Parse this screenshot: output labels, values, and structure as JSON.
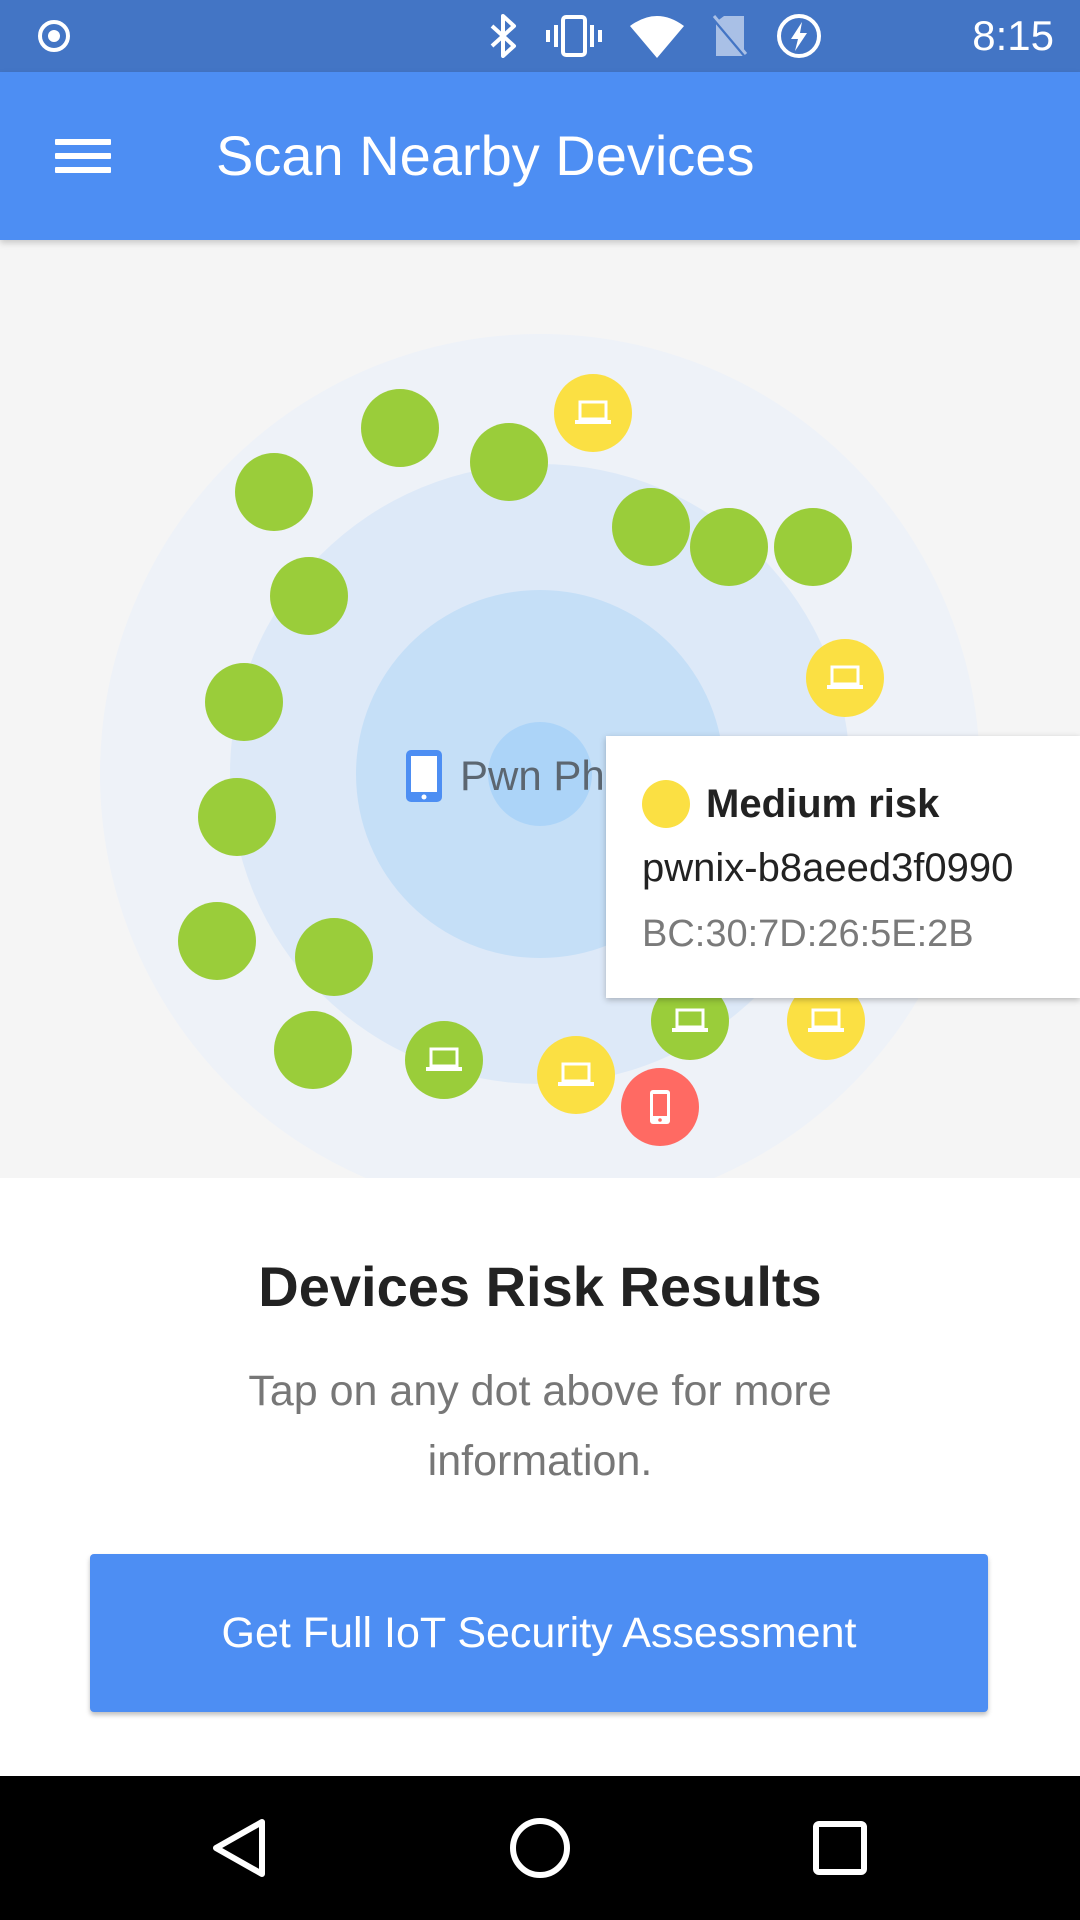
{
  "status_bar": {
    "time": "8:15",
    "icons": [
      "record-icon",
      "bluetooth-icon",
      "vibrate-icon",
      "wifi-icon",
      "no-sim-icon",
      "battery-charging-icon"
    ]
  },
  "app_bar": {
    "title": "Scan Nearby Devices",
    "menu_icon": "menu-icon"
  },
  "radar": {
    "center_label": "Pwn Phone",
    "colors": {
      "low": "#9acd3a",
      "medium": "#fbe043",
      "high": "#ff6a63",
      "accent": "#4d8ef3"
    },
    "devices": [
      {
        "risk": "low",
        "icon": "none"
      },
      {
        "risk": "medium",
        "icon": "laptop-icon"
      },
      {
        "risk": "low",
        "icon": "none"
      },
      {
        "risk": "low",
        "icon": "none"
      },
      {
        "risk": "low",
        "icon": "none"
      },
      {
        "risk": "low",
        "icon": "none"
      },
      {
        "risk": "low",
        "icon": "none"
      },
      {
        "risk": "low",
        "icon": "none"
      },
      {
        "risk": "medium",
        "icon": "laptop-icon"
      },
      {
        "risk": "low",
        "icon": "none"
      },
      {
        "risk": "low",
        "icon": "none"
      },
      {
        "risk": "low",
        "icon": "none"
      },
      {
        "risk": "low",
        "icon": "none"
      },
      {
        "risk": "low",
        "icon": "none"
      },
      {
        "risk": "low",
        "icon": "laptop-icon"
      },
      {
        "risk": "medium",
        "icon": "laptop-icon"
      },
      {
        "risk": "low",
        "icon": "laptop-icon"
      },
      {
        "risk": "medium",
        "icon": "laptop-icon"
      },
      {
        "risk": "high",
        "icon": "phone-icon"
      }
    ]
  },
  "tooltip": {
    "risk_label": "Medium risk",
    "device_name": "pwnix-b8aeed3f0990",
    "mac": "BC:30:7D:26:5E:2B"
  },
  "results": {
    "title": "Devices Risk Results",
    "subtitle": "Tap on any dot above for more information."
  },
  "cta": {
    "label": "Get Full IoT Security Assessment"
  },
  "nav_bar": {
    "buttons": [
      "back-icon",
      "home-icon",
      "recents-icon"
    ]
  }
}
